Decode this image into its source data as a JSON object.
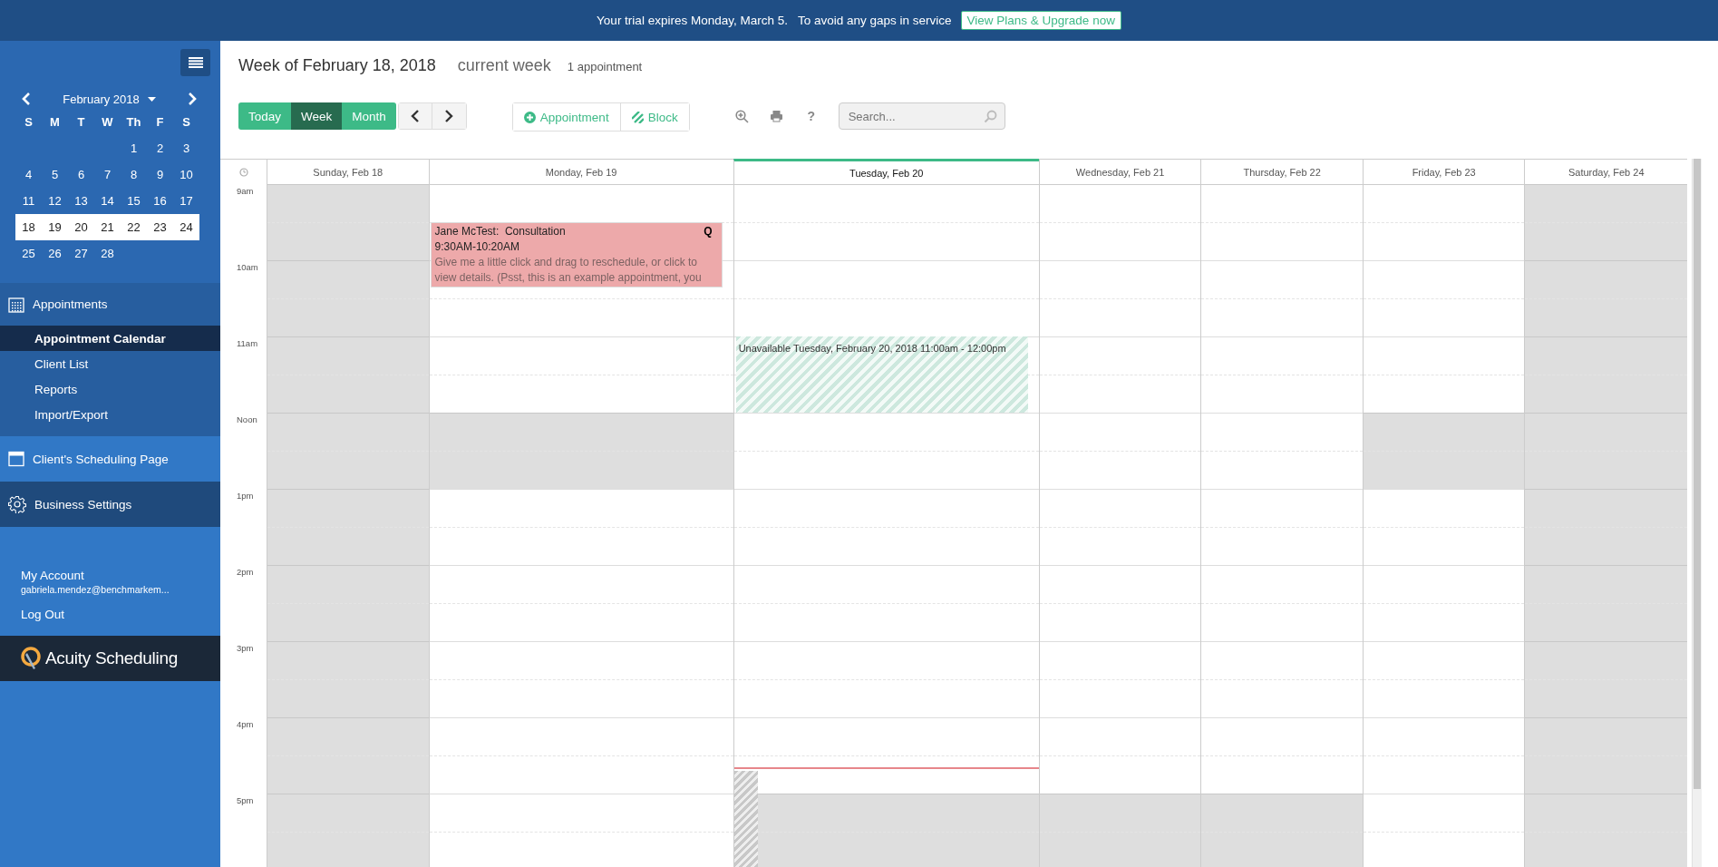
{
  "banner": {
    "message": "Your trial expires Monday, March 5.   To avoid any gaps in service",
    "link": "View Plans & Upgrade now"
  },
  "sidebar": {
    "mini_calendar": {
      "month": "February 2018",
      "weekdays": [
        "S",
        "M",
        "T",
        "W",
        "Th",
        "F",
        "S"
      ],
      "weeks": [
        {
          "cells": [
            {
              "kind": "blank"
            },
            {
              "kind": "blank"
            },
            {
              "kind": "blank"
            },
            {
              "kind": "blank"
            },
            {
              "kind": "day",
              "label": "1"
            },
            {
              "kind": "day",
              "label": "2"
            },
            {
              "kind": "day",
              "label": "3"
            }
          ],
          "selected": false
        },
        {
          "cells": [
            {
              "kind": "day",
              "label": "4"
            },
            {
              "kind": "day",
              "label": "5"
            },
            {
              "kind": "day",
              "label": "6"
            },
            {
              "kind": "day",
              "label": "7"
            },
            {
              "kind": "day",
              "label": "8"
            },
            {
              "kind": "day",
              "label": "9"
            },
            {
              "kind": "day",
              "label": "10"
            }
          ],
          "selected": false
        },
        {
          "cells": [
            {
              "kind": "day",
              "label": "11"
            },
            {
              "kind": "day",
              "label": "12"
            },
            {
              "kind": "day",
              "label": "13"
            },
            {
              "kind": "day",
              "label": "14"
            },
            {
              "kind": "day",
              "label": "15"
            },
            {
              "kind": "day",
              "label": "16"
            },
            {
              "kind": "day",
              "label": "17"
            }
          ],
          "selected": false
        },
        {
          "cells": [
            {
              "kind": "day",
              "label": "18"
            },
            {
              "kind": "day",
              "label": "19"
            },
            {
              "kind": "day",
              "label": "20"
            },
            {
              "kind": "day",
              "label": "21"
            },
            {
              "kind": "day",
              "label": "22"
            },
            {
              "kind": "day",
              "label": "23"
            },
            {
              "kind": "day",
              "label": "24"
            }
          ],
          "selected": true
        },
        {
          "cells": [
            {
              "kind": "day",
              "label": "25"
            },
            {
              "kind": "day",
              "label": "26"
            },
            {
              "kind": "day",
              "label": "27"
            },
            {
              "kind": "day",
              "label": "28"
            },
            {
              "kind": "blank"
            },
            {
              "kind": "blank"
            },
            {
              "kind": "blank"
            }
          ],
          "selected": false
        }
      ]
    },
    "sections": [
      {
        "kind": "group",
        "label": "Appointments",
        "items": [
          {
            "label": "Appointment Calendar",
            "selected": true
          },
          {
            "label": "Client List",
            "selected": false
          },
          {
            "label": "Reports",
            "selected": false
          },
          {
            "label": "Import/Export",
            "selected": false
          }
        ]
      },
      {
        "kind": "page",
        "label": "Client's Scheduling Page",
        "hovered": false
      },
      {
        "kind": "settings",
        "label": "Business Settings",
        "hovered": true
      }
    ],
    "account": {
      "label": "My Account",
      "email": "gabriela.mendez@benchmarkem...",
      "logout": "Log Out"
    },
    "logo": "Acuity Scheduling"
  },
  "header": {
    "title": "Week of February 18, 2018",
    "subtitle": "current week",
    "count": "1 appointment"
  },
  "toolbar": {
    "views": [
      {
        "label": "Today",
        "selected": false
      },
      {
        "label": "Week",
        "selected": true
      },
      {
        "label": "Month",
        "selected": false
      }
    ],
    "add_appointment": "Appointment",
    "add_block": "Block",
    "help": "?",
    "search": {
      "placeholder": "Search..."
    }
  },
  "calendar": {
    "hours": [
      "9am",
      "10am",
      "11am",
      "Noon",
      "1pm",
      "2pm",
      "3pm",
      "4pm",
      "5pm"
    ],
    "days": [
      {
        "label": "Sunday, Feb 18",
        "today": false,
        "half_hours": [
          {
            "unavailable": true
          },
          {
            "unavailable": true
          },
          {
            "unavailable": true
          },
          {
            "unavailable": true
          },
          {
            "unavailable": true
          },
          {
            "unavailable": true
          },
          {
            "unavailable": true
          },
          {
            "unavailable": true
          },
          {
            "unavailable": true
          },
          {
            "unavailable": true
          },
          {
            "unavailable": true
          },
          {
            "unavailable": true
          },
          {
            "unavailable": true
          },
          {
            "unavailable": true
          },
          {
            "unavailable": true
          },
          {
            "unavailable": true
          },
          {
            "unavailable": true
          },
          {
            "unavailable": true
          }
        ]
      },
      {
        "label": "Monday, Feb 19",
        "today": false,
        "half_hours": [
          {
            "unavailable": false
          },
          {
            "unavailable": false,
            "event": {
              "kind": "appointment",
              "client": "Jane McTest:",
              "type": "Consultation",
              "flag": "Q",
              "time": "9:30AM-10:20AM",
              "note": "Give me a little click and drag to reschedule, or click to view details. (Psst, this is an example appointment, you"
            }
          },
          {
            "unavailable": false
          },
          {
            "unavailable": false
          },
          {
            "unavailable": false
          },
          {
            "unavailable": false
          },
          {
            "unavailable": true
          },
          {
            "unavailable": true
          },
          {
            "unavailable": false
          },
          {
            "unavailable": false
          },
          {
            "unavailable": false
          },
          {
            "unavailable": false
          },
          {
            "unavailable": false
          },
          {
            "unavailable": false
          },
          {
            "unavailable": false
          },
          {
            "unavailable": false
          },
          {
            "unavailable": false
          },
          {
            "unavailable": false
          }
        ]
      },
      {
        "label": "Tuesday, Feb 20",
        "today": true,
        "now": {
          "level": 0.853
        },
        "half_hours": [
          {
            "unavailable": false
          },
          {
            "unavailable": false
          },
          {
            "unavailable": false
          },
          {
            "unavailable": false
          },
          {
            "unavailable": false,
            "event": {
              "kind": "block",
              "text": "Unavailable Tuesday, February 20, 2018 11:00am - 12:00pm"
            }
          },
          {
            "unavailable": false
          },
          {
            "unavailable": false
          },
          {
            "unavailable": false
          },
          {
            "unavailable": false
          },
          {
            "unavailable": false
          },
          {
            "unavailable": false
          },
          {
            "unavailable": false
          },
          {
            "unavailable": false
          },
          {
            "unavailable": false
          },
          {
            "unavailable": false
          },
          {
            "unavailable": false
          },
          {
            "unavailable": true
          },
          {
            "unavailable": true
          }
        ]
      },
      {
        "label": "Wednesday, Feb 21",
        "today": false,
        "half_hours": [
          {
            "unavailable": false
          },
          {
            "unavailable": false
          },
          {
            "unavailable": false
          },
          {
            "unavailable": false
          },
          {
            "unavailable": false
          },
          {
            "unavailable": false
          },
          {
            "unavailable": false
          },
          {
            "unavailable": false
          },
          {
            "unavailable": false
          },
          {
            "unavailable": false
          },
          {
            "unavailable": false
          },
          {
            "unavailable": false
          },
          {
            "unavailable": false
          },
          {
            "unavailable": false
          },
          {
            "unavailable": false
          },
          {
            "unavailable": false
          },
          {
            "unavailable": true
          },
          {
            "unavailable": true
          }
        ]
      },
      {
        "label": "Thursday, Feb 22",
        "today": false,
        "half_hours": [
          {
            "unavailable": false
          },
          {
            "unavailable": false
          },
          {
            "unavailable": false
          },
          {
            "unavailable": false
          },
          {
            "unavailable": false
          },
          {
            "unavailable": false
          },
          {
            "unavailable": false
          },
          {
            "unavailable": false
          },
          {
            "unavailable": false
          },
          {
            "unavailable": false
          },
          {
            "unavailable": false
          },
          {
            "unavailable": false
          },
          {
            "unavailable": false
          },
          {
            "unavailable": false
          },
          {
            "unavailable": false
          },
          {
            "unavailable": false
          },
          {
            "unavailable": true
          },
          {
            "unavailable": true
          }
        ]
      },
      {
        "label": "Friday, Feb 23",
        "today": false,
        "half_hours": [
          {
            "unavailable": false
          },
          {
            "unavailable": false
          },
          {
            "unavailable": false
          },
          {
            "unavailable": false
          },
          {
            "unavailable": false
          },
          {
            "unavailable": false
          },
          {
            "unavailable": true
          },
          {
            "unavailable": true
          },
          {
            "unavailable": false
          },
          {
            "unavailable": false
          },
          {
            "unavailable": false
          },
          {
            "unavailable": false
          },
          {
            "unavailable": false
          },
          {
            "unavailable": false
          },
          {
            "unavailable": false
          },
          {
            "unavailable": false
          },
          {
            "unavailable": false
          },
          {
            "unavailable": false
          }
        ]
      },
      {
        "label": "Saturday, Feb 24",
        "today": false,
        "half_hours": [
          {
            "unavailable": true
          },
          {
            "unavailable": true
          },
          {
            "unavailable": true
          },
          {
            "unavailable": true
          },
          {
            "unavailable": true
          },
          {
            "unavailable": true
          },
          {
            "unavailable": true
          },
          {
            "unavailable": true
          },
          {
            "unavailable": true
          },
          {
            "unavailable": true
          },
          {
            "unavailable": true
          },
          {
            "unavailable": true
          },
          {
            "unavailable": true
          },
          {
            "unavailable": true
          },
          {
            "unavailable": true
          },
          {
            "unavailable": true
          },
          {
            "unavailable": true
          },
          {
            "unavailable": true
          }
        ]
      }
    ]
  }
}
